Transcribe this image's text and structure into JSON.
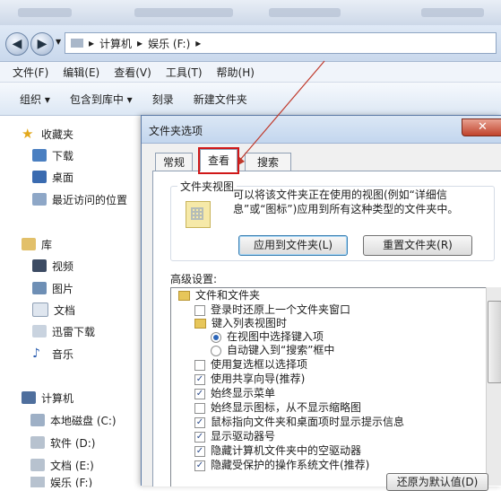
{
  "address": {
    "path_separator": "▸",
    "segments": [
      "计算机",
      "娱乐 (F:)"
    ]
  },
  "menubar": {
    "items": [
      "文件(F)",
      "编辑(E)",
      "查看(V)",
      "工具(T)",
      "帮助(H)"
    ]
  },
  "toolbar": {
    "organize": "组织 ▾",
    "include_library": "包含到库中 ▾",
    "burn": "刻录",
    "new_folder": "新建文件夹"
  },
  "sidebar": {
    "favorites": {
      "label": "收藏夹",
      "items": [
        "下载",
        "桌面",
        "最近访问的位置"
      ]
    },
    "libraries": {
      "label": "库",
      "items": [
        "视频",
        "图片",
        "文档",
        "迅雷下载",
        "音乐"
      ]
    },
    "computer": {
      "label": "计算机",
      "items": [
        "本地磁盘 (C:)",
        "软件 (D:)",
        "文档 (E:)",
        "娱乐 (F:)"
      ]
    }
  },
  "dialog": {
    "title": "文件夹选项",
    "close": "✕",
    "tabs": [
      "常规",
      "查看",
      "搜索"
    ],
    "active_tab": "查看",
    "folder_views": {
      "label": "文件夹视图",
      "description": "可以将该文件夹正在使用的视图(例如“详细信息”或“图标”)应用到所有这种类型的文件夹中。",
      "apply_button": "应用到文件夹(L)",
      "reset_button": "重置文件夹(R)"
    },
    "advanced": {
      "label": "高级设置:",
      "items": [
        {
          "type": "folder",
          "text": "文件和文件夹"
        },
        {
          "type": "checkbox",
          "checked": false,
          "text": "登录时还原上一个文件夹窗口"
        },
        {
          "type": "folder",
          "text": "键入列表视图时"
        },
        {
          "type": "radio",
          "checked": true,
          "text": "在视图中选择键入项"
        },
        {
          "type": "radio",
          "checked": false,
          "text": "自动键入到“搜索”框中"
        },
        {
          "type": "checkbox",
          "checked": false,
          "text": "使用复选框以选择项"
        },
        {
          "type": "checkbox",
          "checked": true,
          "text": "使用共享向导(推荐)"
        },
        {
          "type": "checkbox",
          "checked": true,
          "text": "始终显示菜单"
        },
        {
          "type": "checkbox",
          "checked": false,
          "text": "始终显示图标，从不显示缩略图"
        },
        {
          "type": "checkbox",
          "checked": true,
          "text": "鼠标指向文件夹和桌面项时显示提示信息"
        },
        {
          "type": "checkbox",
          "checked": true,
          "text": "显示驱动器号"
        },
        {
          "type": "checkbox",
          "checked": true,
          "text": "隐藏计算机文件夹中的空驱动器"
        },
        {
          "type": "checkbox",
          "checked": true,
          "text": "隐藏受保护的操作系统文件(推荐)"
        }
      ],
      "restore_button": "还原为默认值(D)"
    }
  },
  "colors": {
    "highlight_red": "#d01818",
    "arrow_red": "#c0392b"
  }
}
